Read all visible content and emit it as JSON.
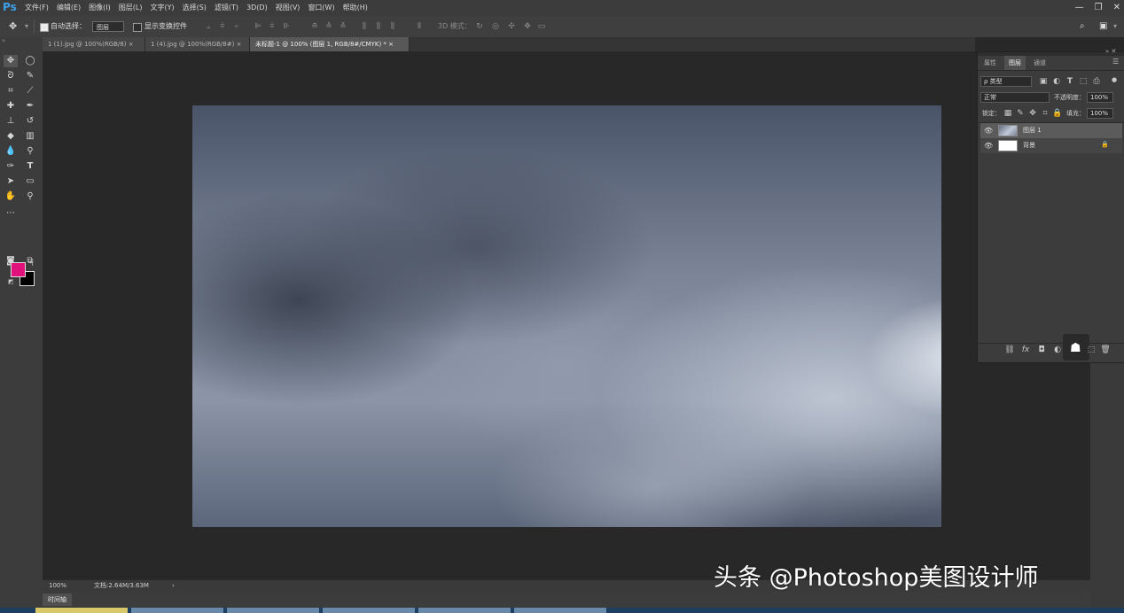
{
  "app": {
    "logo": "Ps"
  },
  "menu": [
    "文件(F)",
    "编辑(E)",
    "图像(I)",
    "图层(L)",
    "文字(Y)",
    "选择(S)",
    "滤镜(T)",
    "3D(D)",
    "视图(V)",
    "窗口(W)",
    "帮助(H)"
  ],
  "window_controls": {
    "minimize": "—",
    "restore": "❐",
    "close": "✕"
  },
  "options": {
    "auto_select_label": "自动选择：",
    "auto_select_value": "图层",
    "show_transform_label": "显示变换控件",
    "mode_3d_label": "3D 模式："
  },
  "tabs": [
    {
      "label": "1 (1).jpg @ 100%(RGB/8)",
      "close": "×"
    },
    {
      "label": "1 (4).jpg @ 100%(RGB/8#)",
      "close": "×"
    },
    {
      "label": "未标题-1 @ 100% (图层 1, RGB/8#/CMYK) *",
      "close": "×",
      "active": true
    }
  ],
  "colors": {
    "foreground": "#e0117a",
    "background": "#000000",
    "accent": "#3c9fe8"
  },
  "status": {
    "zoom": "100%",
    "doc_info": "文档:2.64M/3.63M",
    "arrow": "›"
  },
  "timeline": {
    "label": "时间轴"
  },
  "layers_panel": {
    "tabs": [
      "属性",
      "图层",
      "通道"
    ],
    "active_tab": "图层",
    "filter_kind": "ρ 类型",
    "blend_mode": "正常",
    "opacity_label": "不透明度：",
    "opacity_value": "100%",
    "lock_label": "锁定：",
    "fill_label": "填充：",
    "fill_value": "100%",
    "layers": [
      {
        "name": "图层 1",
        "visible": true,
        "selected": true
      },
      {
        "name": "背景",
        "visible": true,
        "locked": true
      }
    ],
    "bottom_fx": "fx"
  },
  "watermark": "头条 @Photoshop美图设计师"
}
